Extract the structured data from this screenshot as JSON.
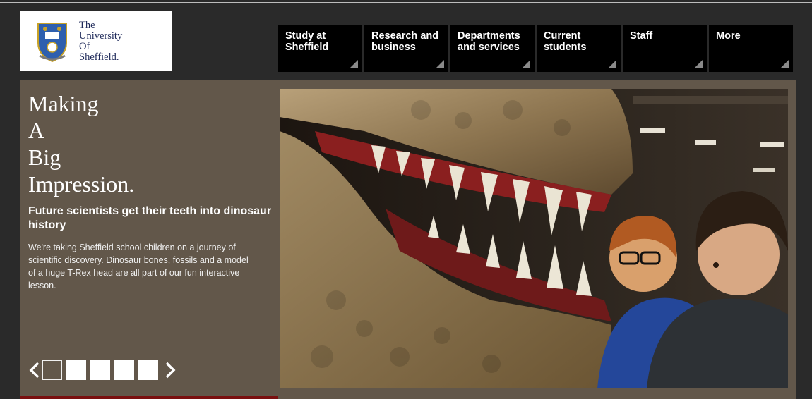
{
  "logo": {
    "lines": [
      "The",
      "University",
      "Of",
      "Sheffield."
    ]
  },
  "nav": {
    "items": [
      {
        "label": "Study at\nSheffield"
      },
      {
        "label": "Research and\nbusiness"
      },
      {
        "label": "Departments\nand services"
      },
      {
        "label": "Current\nstudents"
      },
      {
        "label": "Staff"
      },
      {
        "label": "More"
      }
    ]
  },
  "hero": {
    "headline": [
      "Making",
      "A",
      "Big",
      "Impression."
    ],
    "subhead": "Future scientists get their teeth into dinosaur history",
    "description": "We're taking Sheffield school children on a journey of scientific discovery. Dinosaur bones, fossils and a model of a huge T-Rex head are all part of our fun interactive lesson.",
    "slides": {
      "count": 5,
      "active": 1
    },
    "prev_icon": "chevron-left-icon",
    "next_icon": "chevron-right-icon"
  },
  "colors": {
    "panel": "#62574a",
    "page_bg": "#2a2a2a",
    "nav_bg": "#000000",
    "logo_text": "#1f2a5a"
  }
}
